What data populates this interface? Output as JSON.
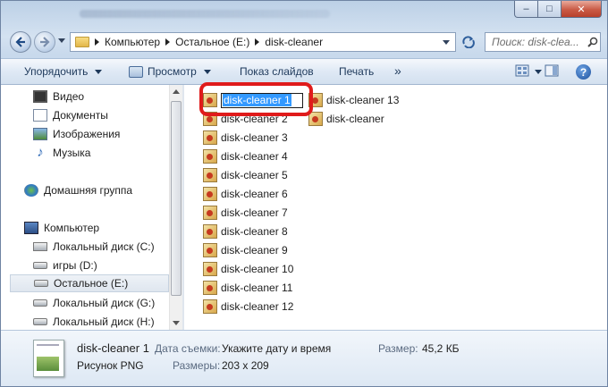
{
  "window": {
    "caption_buttons": {
      "minimize": "–",
      "maximize": "□",
      "close": "✕"
    }
  },
  "address_bar": {
    "crumbs": [
      "Компьютер",
      "Остальное (E:)",
      "disk-cleaner"
    ],
    "search_placeholder": "Поиск: disk-clea..."
  },
  "toolbar": {
    "organize": "Упорядочить",
    "preview": "Просмотр",
    "slideshow": "Показ слайдов",
    "print": "Печать",
    "more": "»",
    "help": "?"
  },
  "sidebar": {
    "items": [
      {
        "label": "Видео",
        "icon": "video-library-icon"
      },
      {
        "label": "Документы",
        "icon": "documents-library-icon"
      },
      {
        "label": "Изображения",
        "icon": "pictures-library-icon"
      },
      {
        "label": "Музыка",
        "icon": "music-library-icon"
      },
      {
        "label": "Домашняя группа",
        "icon": "homegroup-icon"
      },
      {
        "label": "Компьютер",
        "icon": "computer-icon"
      },
      {
        "label": "Локальный диск (C:)",
        "icon": "system-drive-icon"
      },
      {
        "label": "игры (D:)",
        "icon": "drive-icon"
      },
      {
        "label": "Остальное (E:)",
        "icon": "drive-icon",
        "selected": true
      },
      {
        "label": "Локальный диск (G:)",
        "icon": "drive-icon"
      },
      {
        "label": "Локальный диск (H:)",
        "icon": "drive-icon"
      }
    ]
  },
  "files": {
    "renaming_value": "disk-cleaner 1",
    "column1": [
      "disk-cleaner 2",
      "disk-cleaner 3",
      "disk-cleaner 4",
      "disk-cleaner 5",
      "disk-cleaner 6",
      "disk-cleaner 7",
      "disk-cleaner 8",
      "disk-cleaner 9",
      "disk-cleaner 10",
      "disk-cleaner 11",
      "disk-cleaner 12"
    ],
    "column2": [
      "disk-cleaner 13",
      "disk-cleaner"
    ]
  },
  "details": {
    "name": "disk-cleaner 1",
    "type": "Рисунок PNG",
    "date_label": "Дата съемки:",
    "date_value": "Укажите дату и время",
    "dims_label": "Размеры:",
    "dims_value": "203 x 209",
    "size_label": "Размер:",
    "size_value": "45,2 КБ"
  },
  "colors": {
    "highlight": "#e01b1b",
    "selection": "#3399ff"
  }
}
